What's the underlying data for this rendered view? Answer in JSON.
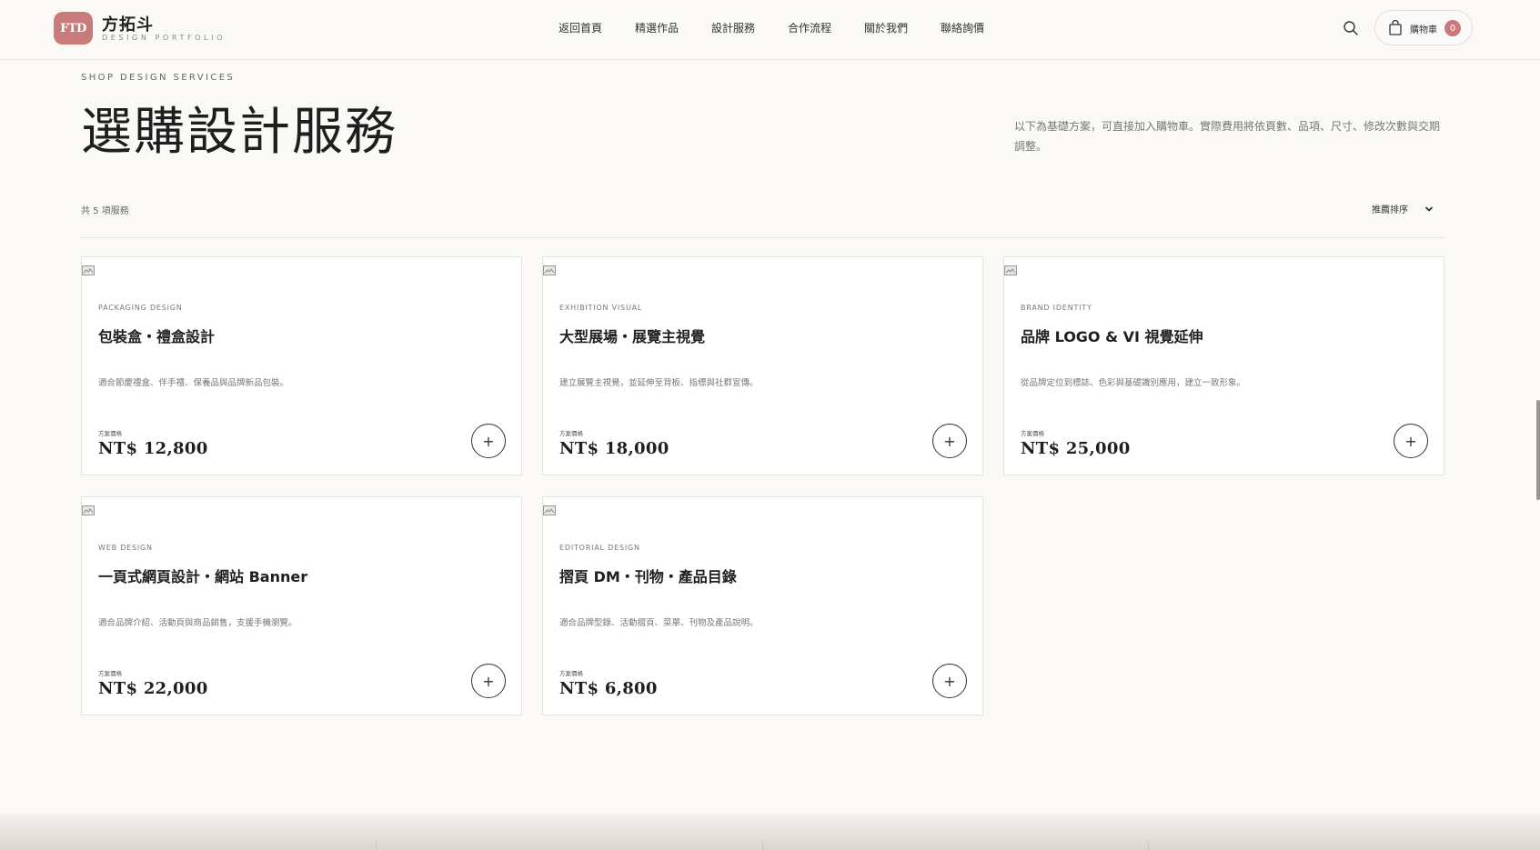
{
  "header": {
    "logo_badge": "FTD",
    "logo_name": "方拓斗",
    "logo_sub": "DESIGN PORTFOLIO",
    "nav": [
      "返回首頁",
      "精選作品",
      "設計服務",
      "合作流程",
      "關於我們",
      "聯絡詢價"
    ],
    "cart_label": "購物車",
    "cart_count": "0"
  },
  "page": {
    "eyebrow": "SHOP DESIGN SERVICES",
    "title": "選購設計服務",
    "description": "以下為基礎方案，可直接加入購物車。實際費用將依頁數、品項、尺寸、修改次數與交期調整。",
    "count": "共 5 項服務",
    "sort_label": "推薦排序"
  },
  "cards": [
    {
      "category": "PACKAGING DESIGN",
      "title": "包裝盒・禮盒設計",
      "description": "適合節慶禮盒、伴手禮、保養品與品牌新品包裝。",
      "price_label": "方案價格",
      "price": "NT$ 12,800",
      "add_label": "+"
    },
    {
      "category": "EXHIBITION VISUAL",
      "title": "大型展場・展覽主視覺",
      "description": "建立展覽主視覺，並延伸至背板、指標與社群宣傳。",
      "price_label": "方案價格",
      "price": "NT$ 18,000",
      "add_label": "+"
    },
    {
      "category": "BRAND IDENTITY",
      "title": "品牌 LOGO & VI 視覺延伸",
      "description": "從品牌定位到標誌、色彩與基礎識別應用，建立一致形象。",
      "price_label": "方案價格",
      "price": "NT$ 25,000",
      "add_label": "+"
    },
    {
      "category": "WEB DESIGN",
      "title": "一頁式網頁設計・網站 Banner",
      "description": "適合品牌介紹、活動頁與商品銷售，支援手機瀏覽。",
      "price_label": "方案價格",
      "price": "NT$ 22,000",
      "add_label": "+"
    },
    {
      "category": "EDITORIAL DESIGN",
      "title": "摺頁 DM・刊物・產品目錄",
      "description": "適合品牌型錄、活動摺頁、菜單、刊物及產品說明。",
      "price_label": "方案價格",
      "price": "NT$ 6,800",
      "add_label": "+"
    }
  ],
  "colors": {
    "accent": "#c97a7a",
    "background": "#faf9f6",
    "card": "#ffffff"
  },
  "icons": {
    "search": "search-icon",
    "cart": "shopping-bag-icon",
    "sort": "chevron-down-icon",
    "card_image": "broken-image-icon"
  }
}
